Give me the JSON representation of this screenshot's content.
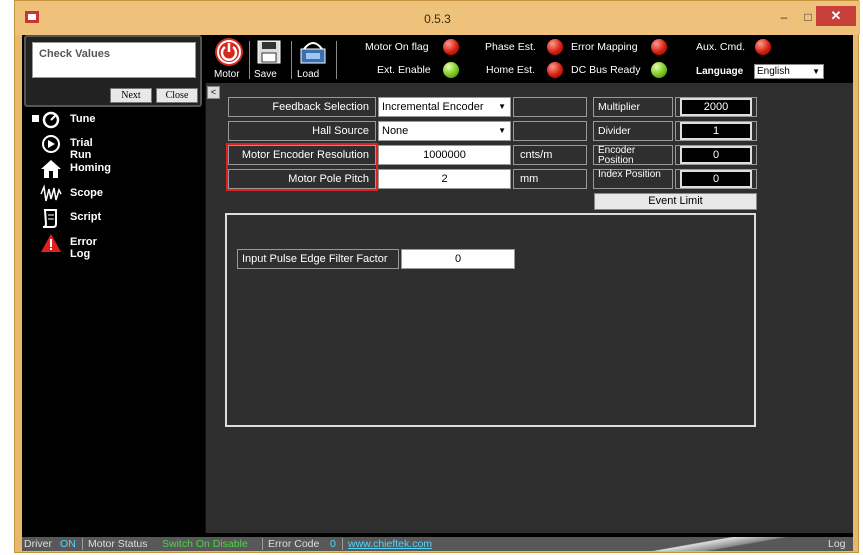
{
  "window": {
    "title": "0.5.3",
    "minimize": "–",
    "maximize": "□",
    "close": "✕"
  },
  "toolbar": {
    "motor_label": "Motor",
    "save_label": "Save",
    "load_label": "Load",
    "flags": [
      {
        "label": "Motor On flag",
        "status": "red"
      },
      {
        "label": "Ext. Enable",
        "status": "green"
      },
      {
        "label": "Phase Est.",
        "status": "red"
      },
      {
        "label": "Home Est.",
        "status": "red"
      },
      {
        "label": "Error Mapping",
        "status": "red"
      },
      {
        "label": "DC Bus Ready",
        "status": "green"
      },
      {
        "label": "Aux. Cmd.",
        "status": "red"
      }
    ],
    "language_label": "Language",
    "language_value": "English"
  },
  "check_panel": {
    "title": "Check Values",
    "next_label": "Next",
    "close_label": "Close"
  },
  "sidebar": {
    "items": [
      {
        "label": "Tune",
        "icon": "tune-icon"
      },
      {
        "label": "Trial Run",
        "icon": "play-icon"
      },
      {
        "label": "Homing",
        "icon": "home-icon"
      },
      {
        "label": "Scope",
        "icon": "scope-icon"
      },
      {
        "label": "Script",
        "icon": "script-icon"
      },
      {
        "label": "Error Log",
        "icon": "warning-icon"
      }
    ]
  },
  "form": {
    "collapse_label": "<",
    "feedback_selection": {
      "label": "Feedback Selection",
      "value": "Incremental Encoder"
    },
    "hall_source": {
      "label": "Hall Source",
      "value": "None"
    },
    "encoder_resolution": {
      "label": "Motor Encoder Resolution",
      "value": "1000000",
      "unit": "cnts/m"
    },
    "pole_pitch": {
      "label": "Motor Pole Pitch",
      "value": "2",
      "unit": "mm"
    },
    "multiplier": {
      "label": "Multiplier",
      "value": "2000"
    },
    "divider": {
      "label": "Divider",
      "value": "1"
    },
    "encoder_position": {
      "label": "Encoder Position",
      "value": "0"
    },
    "index_position": {
      "label": "Index Position",
      "value": "0"
    },
    "event_limit_label": "Event Limit",
    "filter_factor": {
      "label": "Input Pulse Edge Filter Factor",
      "value": "0"
    }
  },
  "statusbar": {
    "driver_label": "Driver",
    "driver_value": "ON",
    "motor_status_label": "Motor Status",
    "motor_status_value": "Switch On Disable",
    "error_code_label": "Error Code",
    "error_code_value": "0",
    "website": "www.chieftek.com",
    "log_label": "Log"
  },
  "colors": {
    "accent_green": "#4cd44c",
    "accent_cyan": "#4fd6ff",
    "highlight_red": "#d22222"
  }
}
